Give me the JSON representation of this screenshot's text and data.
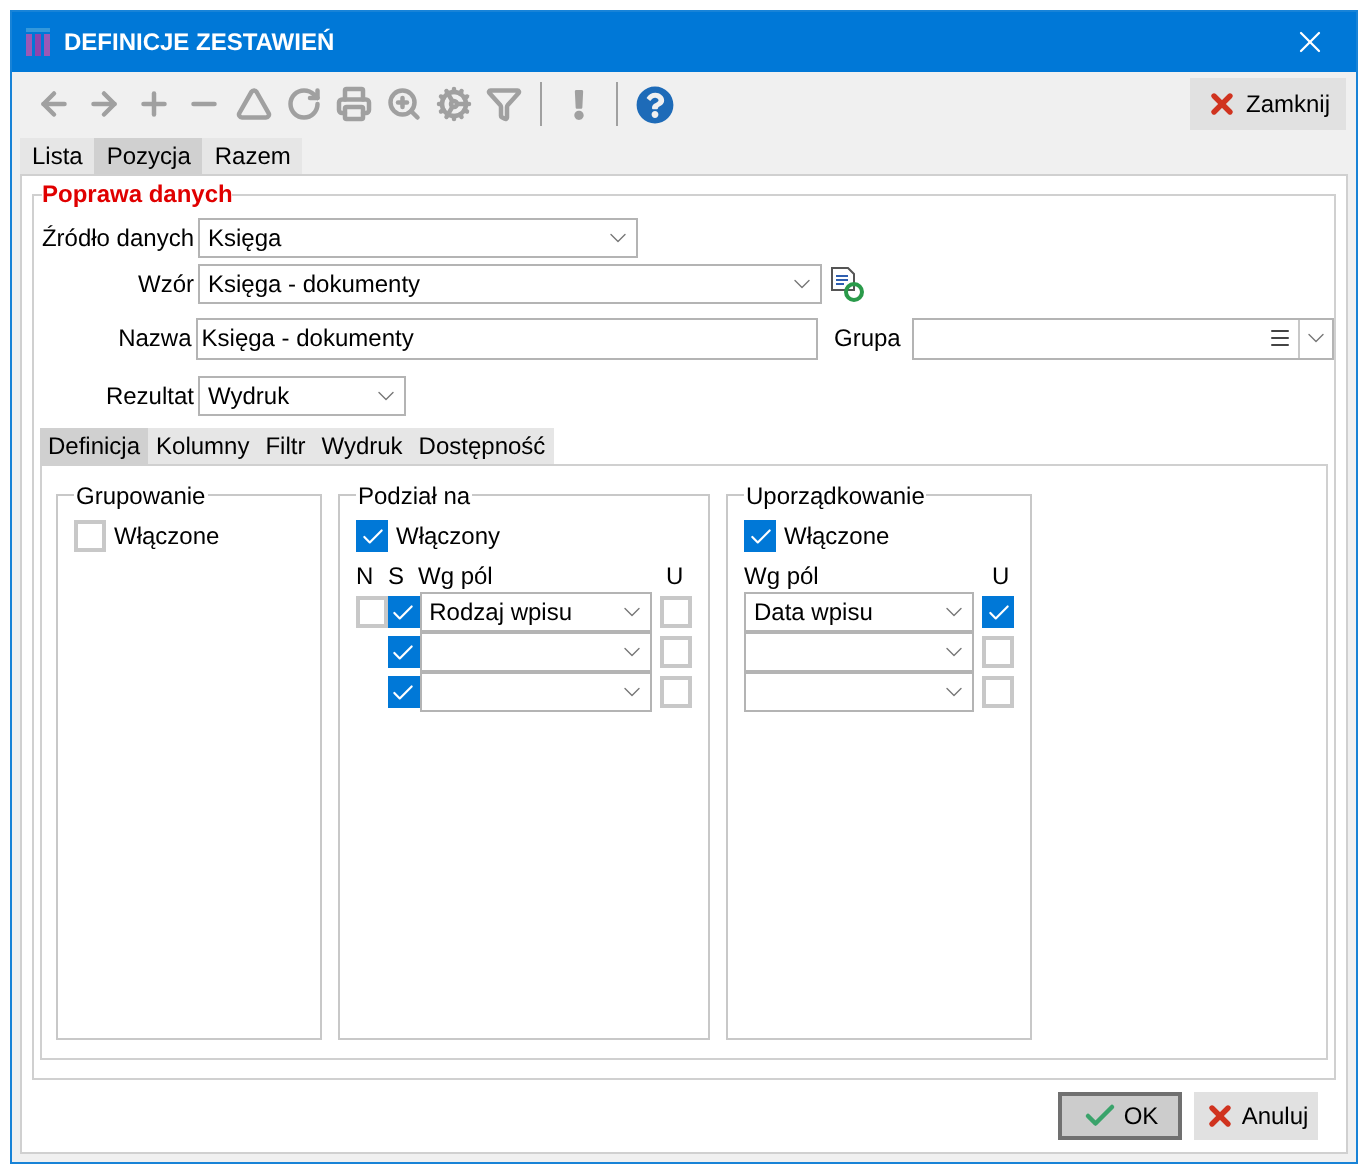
{
  "window": {
    "title": "DEFINICJE ZESTAWIEŃ"
  },
  "toolbar": [
    {
      "kind": "back",
      "disabled": true
    },
    {
      "kind": "forward",
      "disabled": true
    },
    {
      "kind": "add",
      "disabled": true
    },
    {
      "kind": "remove",
      "disabled": true
    },
    {
      "kind": "triangle",
      "disabled": true
    },
    {
      "kind": "refresh",
      "disabled": true
    },
    {
      "kind": "print",
      "disabled": true
    },
    {
      "kind": "zoom",
      "disabled": true
    },
    {
      "kind": "settings",
      "disabled": true
    },
    {
      "kind": "filter",
      "disabled": true
    },
    {
      "kind": "separator"
    },
    {
      "kind": "exclamation",
      "disabled": true
    },
    {
      "kind": "separator"
    },
    {
      "kind": "help",
      "disabled": false
    }
  ],
  "close_button": "Zamknij",
  "tabs": [
    {
      "label": "Lista",
      "selected": false
    },
    {
      "label": "Pozycja",
      "selected": true
    },
    {
      "label": "Razem",
      "selected": false
    }
  ],
  "section_title": "Poprawa danych",
  "form": {
    "source": {
      "label": "Źródło danych",
      "value": "Księga"
    },
    "template": {
      "label": "Wzór",
      "value": "Księga - dokumenty"
    },
    "name": {
      "label": "Nazwa",
      "value": "Księga - dokumenty"
    },
    "group": {
      "label": "Grupa"
    },
    "result": {
      "label": "Rezultat",
      "value": "Wydruk"
    }
  },
  "inner_tabs": [
    {
      "label": "Definicja",
      "selected": true
    },
    {
      "label": "Kolumny",
      "selected": false
    },
    {
      "label": "Filtr",
      "selected": false
    },
    {
      "label": "Wydruk",
      "selected": false
    },
    {
      "label": "Dostępność",
      "selected": false
    }
  ],
  "grouping": {
    "title": "Grupowanie",
    "enabled_label": "Włączone",
    "checked": false
  },
  "split": {
    "title": "Podział na",
    "enabled_label": "Włączony",
    "checked": true,
    "col_n": "N",
    "col_s": "S",
    "col_field": "Wg pól",
    "col_u": "U",
    "rows": [
      {
        "n": false,
        "s": true,
        "field": "Rodzaj wpisu",
        "u": false
      },
      {
        "s": true,
        "u": false
      },
      {
        "s": true,
        "u": false
      }
    ]
  },
  "ordering": {
    "title": "Uporządkowanie",
    "enabled_label": "Włączone",
    "checked": true,
    "col_field": "Wg pól",
    "col_u": "U",
    "rows": [
      {
        "field": "Data wpisu",
        "u": true
      },
      {
        "u": false
      },
      {
        "u": false
      }
    ]
  },
  "buttons": {
    "ok": "OK",
    "cancel": "Anuluj"
  }
}
